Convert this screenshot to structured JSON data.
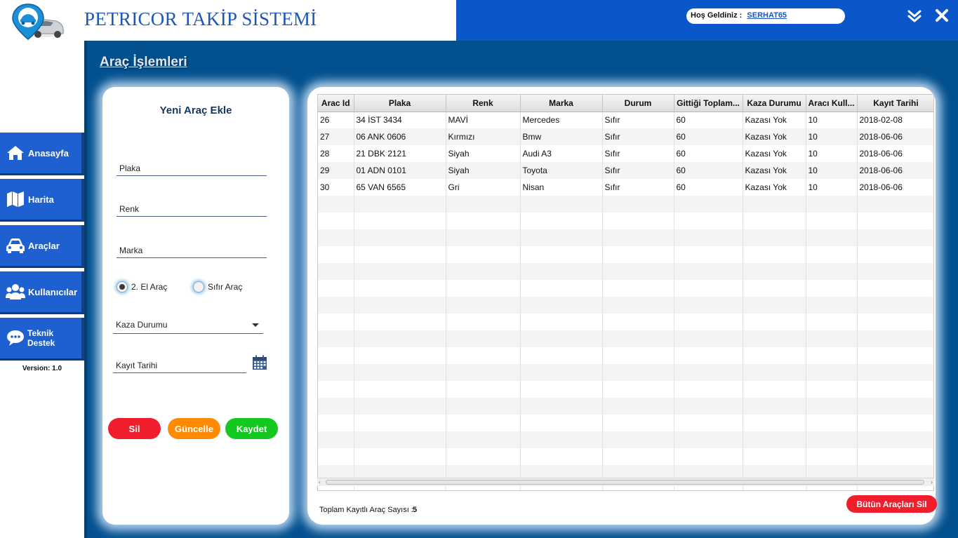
{
  "header": {
    "title": "PETRICOR TAKİP SİSTEMİ",
    "welcome_label": "Hoş Geldiniz :",
    "username": "SERHAT65",
    "minimize_icon": "double-chevron-down-icon",
    "close_icon": "close-icon"
  },
  "sidebar": {
    "items": [
      {
        "label": "Anasayfa",
        "icon": "home-icon"
      },
      {
        "label": "Harita",
        "icon": "map-icon"
      },
      {
        "label": "Araçlar",
        "icon": "car-icon"
      },
      {
        "label": "Kullanıcılar",
        "icon": "users-icon"
      },
      {
        "label": "Teknik Destek",
        "icon": "chat-icon"
      }
    ],
    "version": "Version: 1.0"
  },
  "main": {
    "section_title": "Araç İşlemleri"
  },
  "form": {
    "title": "Yeni Araç Ekle",
    "plaka_placeholder": "Plaka",
    "renk_placeholder": "Renk",
    "marka_placeholder": "Marka",
    "radio_used": "2. El Araç",
    "radio_new": "Sıfır Araç",
    "radio_selected": "2. El Araç",
    "kaza_placeholder": "Kaza Durumu",
    "tarih_placeholder": "Kayıt Tarihi",
    "btn_delete": "Sil",
    "btn_update": "Güncelle",
    "btn_save": "Kaydet"
  },
  "colors": {
    "header_blue": "#0b57c9",
    "main_blue": "#02508e",
    "nav_blue": "#1e60cf",
    "delete_red": "#f01e2c",
    "update_orange": "#ff8a00",
    "save_green": "#13c81f"
  },
  "table": {
    "columns": [
      "Arac Id",
      "Plaka",
      "Renk",
      "Marka",
      "Durum",
      "Gittiği Toplam...",
      "Kaza Durumu",
      "Aracı Kull...",
      "Kayıt Tarihi"
    ],
    "rows": [
      [
        "26",
        "34 İST 3434",
        "MAVİ",
        "Mercedes",
        "Sıfır",
        "60",
        "Kazası Yok",
        "10",
        "2018-02-08"
      ],
      [
        "27",
        "06 ANK 0606",
        "Kırmızı",
        "Bmw",
        "Sıfır",
        "60",
        "Kazası Yok",
        "10",
        "2018-06-06"
      ],
      [
        "28",
        "21 DBK 2121",
        "Siyah",
        "Audi A3",
        "Sıfır",
        "60",
        "Kazası Yok",
        "10",
        "2018-06-06"
      ],
      [
        "29",
        "01 ADN 0101",
        "Siyah",
        "Toyota",
        "Sıfır",
        "60",
        "Kazası Yok",
        "10",
        "2018-06-06"
      ],
      [
        "30",
        "65 VAN 6565",
        "Gri",
        "Nisan",
        "Sıfır",
        "60",
        "Kazası Yok",
        "10",
        "2018-06-06"
      ]
    ],
    "total_label": "Toplam Kayıtlı Araç Sayısı :",
    "total_value": "5",
    "delete_all": "Bütün Araçları Sil"
  }
}
